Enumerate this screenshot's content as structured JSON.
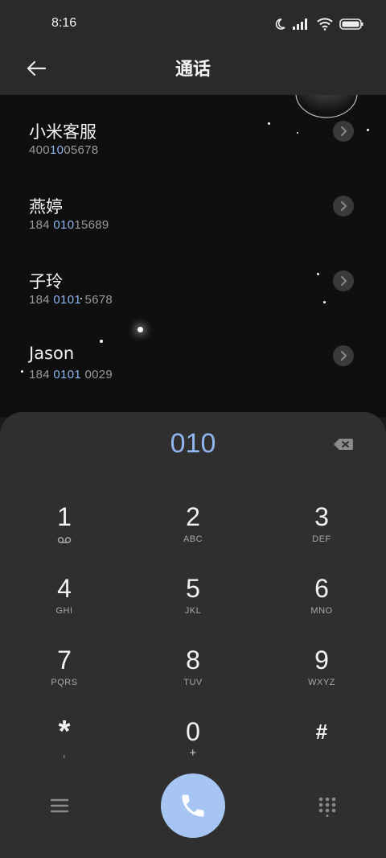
{
  "status_bar": {
    "time": "8:16"
  },
  "app_bar": {
    "title": "通话"
  },
  "contacts": [
    {
      "name": "小米客服",
      "num_pre": "400",
      "num_hl": "10",
      "num_post": "05678"
    },
    {
      "name": "燕婷",
      "num_pre": "184 ",
      "num_hl": "010",
      "num_post": "15689"
    },
    {
      "name": "子玲",
      "num_pre": "184 ",
      "num_hl": "0101",
      "num_post": " 5678"
    },
    {
      "name": "Jason",
      "num_pre": "184 ",
      "num_hl": "0101",
      "num_post": " 0029"
    }
  ],
  "dialpad": {
    "dialed_number": "010",
    "keys": [
      {
        "digit": "1",
        "letters": ""
      },
      {
        "digit": "2",
        "letters": "ABC"
      },
      {
        "digit": "3",
        "letters": "DEF"
      },
      {
        "digit": "4",
        "letters": "GHI"
      },
      {
        "digit": "5",
        "letters": "JKL"
      },
      {
        "digit": "6",
        "letters": "MNO"
      },
      {
        "digit": "7",
        "letters": "PQRS"
      },
      {
        "digit": "8",
        "letters": "TUV"
      },
      {
        "digit": "9",
        "letters": "WXYZ"
      },
      {
        "digit": "*",
        "letters": ","
      },
      {
        "digit": "0",
        "letters": "+"
      },
      {
        "digit": "#",
        "letters": ""
      }
    ]
  },
  "colors": {
    "accent": "#8fb6ef",
    "call_button": "#a6c5f2",
    "pad_bg": "#2f2f2f"
  },
  "icons": [
    "back-arrow-icon",
    "moon-icon",
    "signal-icon",
    "wifi-icon",
    "battery-icon",
    "chevron-right-icon",
    "backspace-icon",
    "voicemail-icon",
    "phone-icon",
    "menu-icon",
    "dialpad-grid-icon"
  ]
}
